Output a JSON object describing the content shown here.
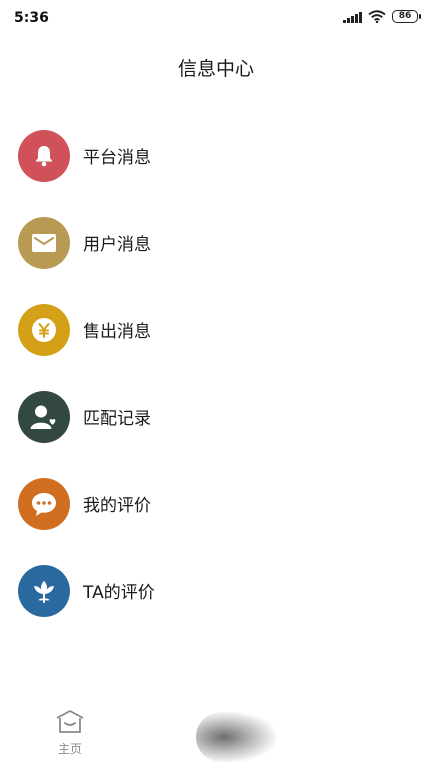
{
  "status_bar": {
    "time": "5:36",
    "battery_level": "86",
    "signal_icon": "signal-bars-icon",
    "wifi_icon": "wifi-icon"
  },
  "header": {
    "title": "信息中心"
  },
  "menu": {
    "items": [
      {
        "label": "平台消息",
        "icon": "bell-icon",
        "color": "#d0515a"
      },
      {
        "label": "用户消息",
        "icon": "envelope-icon",
        "color": "#b99a55"
      },
      {
        "label": "售出消息",
        "icon": "yen-coin-icon",
        "color": "#d4a017"
      },
      {
        "label": "匹配记录",
        "icon": "user-heart-icon",
        "color": "#334842"
      },
      {
        "label": "我的评价",
        "icon": "chat-bubble-icon",
        "color": "#d06f22"
      },
      {
        "label": "TA的评价",
        "icon": "flower-icon",
        "color": "#2a6aa0"
      }
    ]
  },
  "tab_bar": {
    "home_label": "主页",
    "home_icon": "house-icon"
  }
}
